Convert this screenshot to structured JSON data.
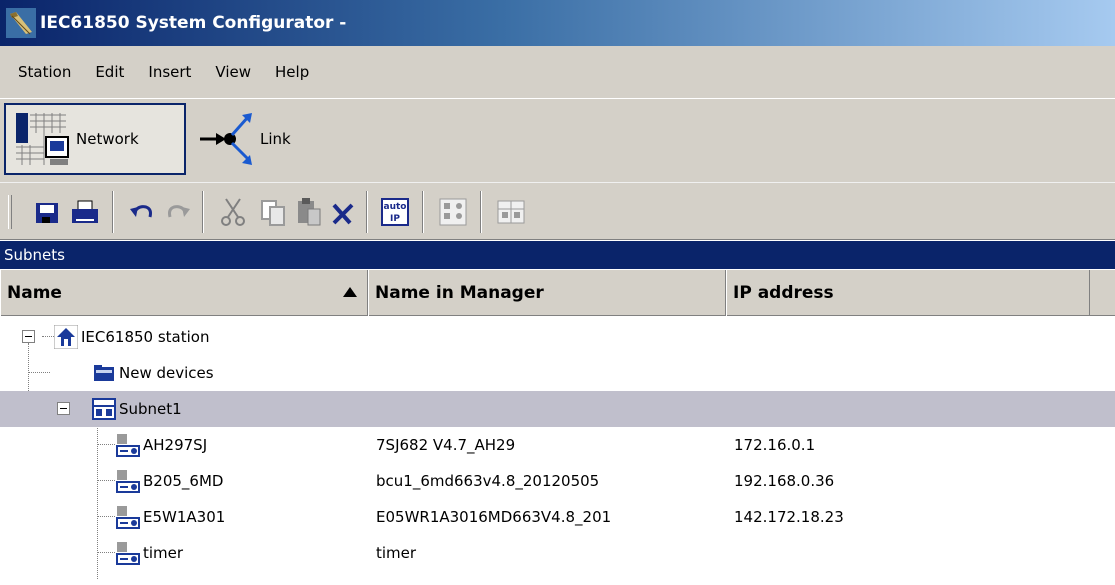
{
  "window": {
    "title": "IEC61850 System Configurator -"
  },
  "menu": [
    "Station",
    "Edit",
    "Insert",
    "View",
    "Help"
  ],
  "modes": {
    "network_label": "Network",
    "link_label": "Link"
  },
  "toolbar": {
    "auto_ip_top": "auto",
    "auto_ip_bottom": "IP"
  },
  "panel": {
    "title": "Subnets"
  },
  "columns": {
    "name": "Name",
    "manager": "Name in Manager",
    "ip": "IP address"
  },
  "tree": {
    "station": "IEC61850 station",
    "new_devices": "New devices",
    "subnet": "Subnet1",
    "devices": [
      {
        "name": "AH297SJ",
        "manager": "7SJ682 V4.7_AH29",
        "ip": "172.16.0.1"
      },
      {
        "name": "B205_6MD",
        "manager": "bcu1_6md663v4.8_20120505",
        "ip": "192.168.0.36"
      },
      {
        "name": "E5W1A301",
        "manager": "E05WR1A3016MD663V4.8_201",
        "ip": "142.172.18.23"
      },
      {
        "name": "timer",
        "manager": "timer",
        "ip": ""
      }
    ]
  },
  "colors": {
    "title_start": "#0a246a",
    "title_end": "#a6caf0",
    "selected_row": "#c0bfcc",
    "chrome": "#d4d0c8"
  }
}
